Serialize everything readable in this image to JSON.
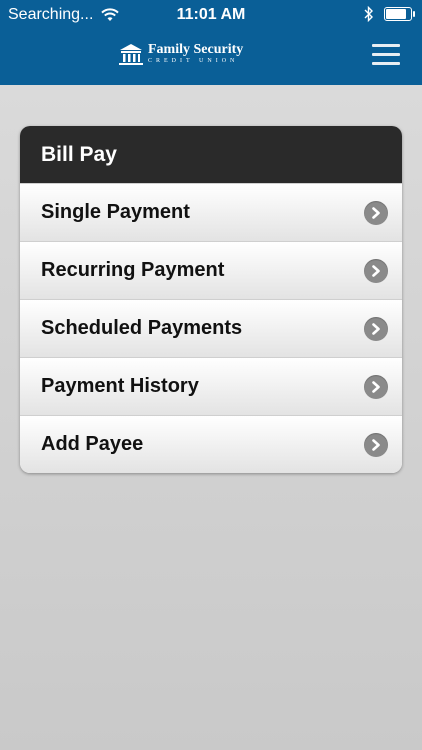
{
  "status_bar": {
    "carrier": "Searching...",
    "time": "11:01 AM",
    "battery_level": 0.9
  },
  "header": {
    "brand_name": "Family Security",
    "brand_sub": "CREDIT UNION",
    "menu_icon": "hamburger-icon"
  },
  "card": {
    "title": "Bill Pay",
    "items": [
      {
        "label": "Single Payment"
      },
      {
        "label": "Recurring Payment"
      },
      {
        "label": "Scheduled Payments"
      },
      {
        "label": "Payment History"
      },
      {
        "label": "Add Payee"
      }
    ]
  },
  "colors": {
    "header_bg": "#0a5f97",
    "card_header_bg": "#2a2a2a",
    "chevron_bg": "#8a8a8a"
  }
}
